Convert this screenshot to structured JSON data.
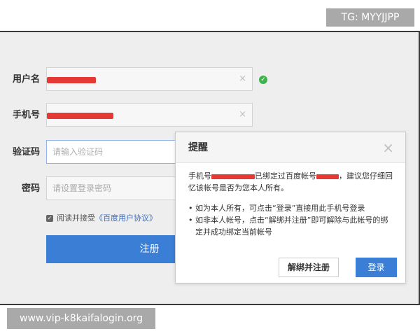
{
  "watermark": {
    "top_text": "TG: MYYJJPP",
    "bottom_text": "www.vip-k8kaifalogin.org"
  },
  "form": {
    "username_label": "用户名",
    "phone_label": "手机号",
    "verify_label": "验证码",
    "verify_placeholder": "请输入验证码",
    "password_label": "密码",
    "password_placeholder": "请设置登录密码",
    "clear_glyph": "×",
    "check_glyph": "✓",
    "agree_text": "阅读并接受",
    "agree_link": "《百度用户协议》",
    "register_label": "注册"
  },
  "dialog": {
    "title": "提醒",
    "close_glyph": "×",
    "para_prefix": "手机号",
    "para_mid": "已绑定过百度帐号",
    "para_suffix": "，建议您仔细回忆该帐号是否为您本人所有。",
    "bullet1": "如为本人所有，可点击“登录”直接用此手机号登录",
    "bullet2": "如非本人帐号，点击“解绑并注册”即可解除与此帐号的绑定并成功绑定当前帐号",
    "unbind_button": "解绑并注册",
    "login_button": "登录"
  },
  "colors": {
    "primary": "#3a7fd5",
    "redaction": "#e53935",
    "success": "#3bb54a"
  }
}
